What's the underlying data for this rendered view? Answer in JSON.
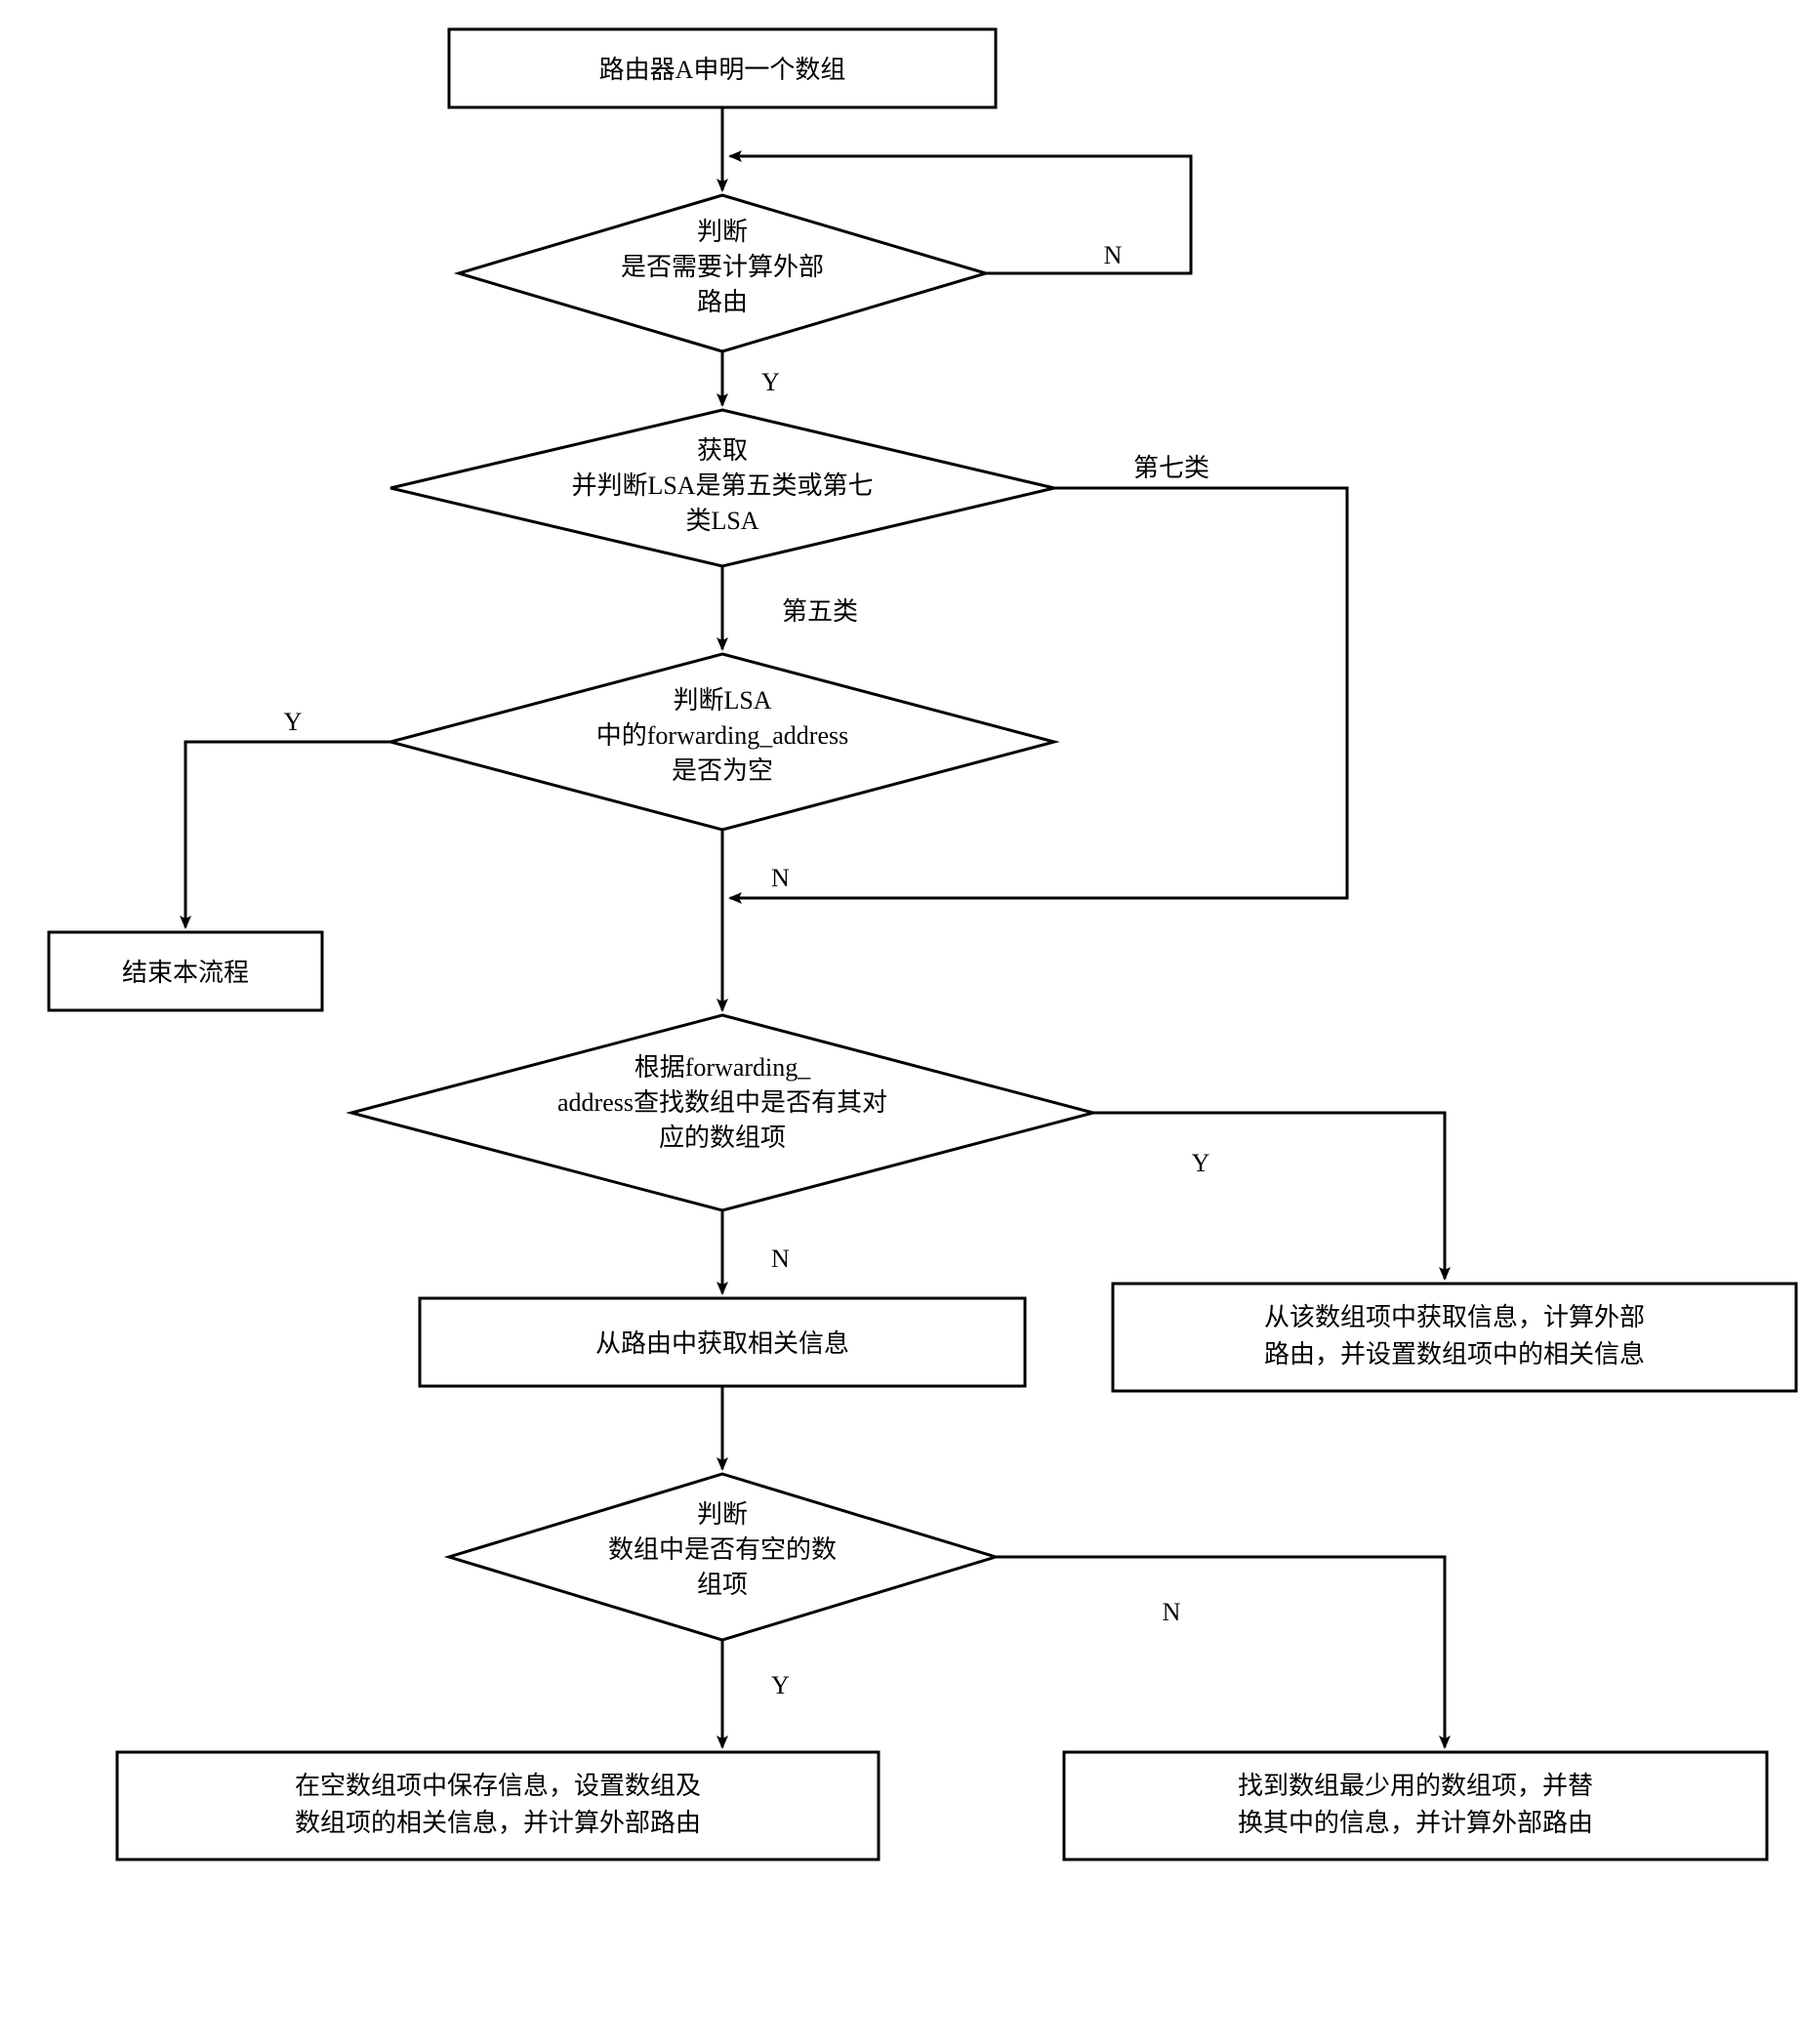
{
  "nodes": {
    "start": {
      "lines": [
        "路由器A申明一个数组"
      ]
    },
    "d1": {
      "lines": [
        "判断",
        "是否需要计算外部",
        "路由"
      ]
    },
    "d2": {
      "lines": [
        "获取",
        "并判断LSA是第五类或第七",
        "类LSA"
      ]
    },
    "d3": {
      "lines": [
        "判断LSA",
        "中的forwarding_address",
        "是否为空"
      ]
    },
    "end": {
      "lines": [
        "结束本流程"
      ]
    },
    "d4": {
      "lines": [
        "根据forwarding_",
        "address查找数组中是否有其对",
        "应的数组项"
      ]
    },
    "p1": {
      "lines": [
        "从路由中获取相关信息"
      ]
    },
    "p2": {
      "lines": [
        "从该数组项中获取信息，计算外部",
        "路由，并设置数组项中的相关信息"
      ]
    },
    "d5": {
      "lines": [
        "判断",
        "数组中是否有空的数",
        "组项"
      ]
    },
    "p3": {
      "lines": [
        "在空数组项中保存信息，设置数组及",
        "数组项的相关信息，并计算外部路由"
      ]
    },
    "p4": {
      "lines": [
        "找到数组最少用的数组项，并替",
        "换其中的信息，并计算外部路由"
      ]
    }
  },
  "edgeLabels": {
    "d1_no": "N",
    "d1_yes": "Y",
    "d2_type7": "第七类",
    "d2_type5": "第五类",
    "d3_yes": "Y",
    "d3_no": "N",
    "d4_yes": "Y",
    "d4_no": "N",
    "d5_no": "N",
    "d5_yes": "Y"
  }
}
